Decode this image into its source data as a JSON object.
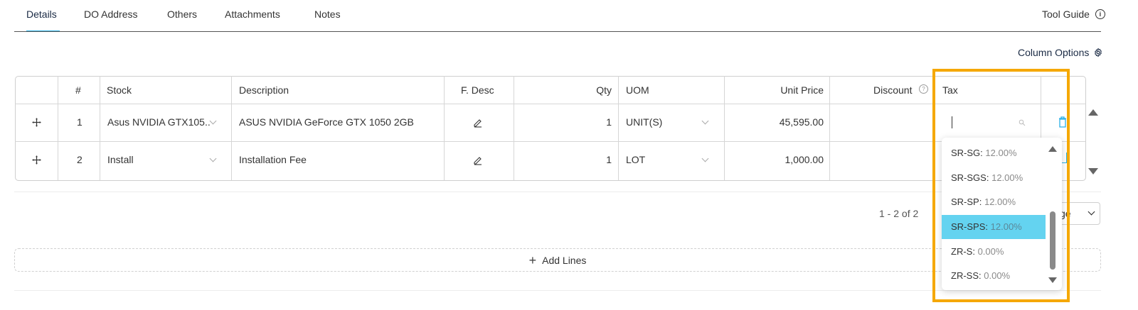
{
  "tabs": [
    {
      "label": "Details"
    },
    {
      "label": "DO Address"
    },
    {
      "label": "Others"
    },
    {
      "label": "Attachments"
    },
    {
      "label": "Notes"
    }
  ],
  "tool_guide": {
    "label": "Tool Guide",
    "icon": "info-icon"
  },
  "column_options": {
    "label": "Column Options",
    "icon": "gear-icon"
  },
  "table": {
    "headers": {
      "num": "#",
      "stock": "Stock",
      "description": "Description",
      "fdesc": "F. Desc",
      "qty": "Qty",
      "uom": "UOM",
      "unit_price": "Unit Price",
      "discount": "Discount",
      "tax": "Tax"
    },
    "rows": [
      {
        "num": "1",
        "stock": "Asus NVIDIA GTX105...",
        "description": "ASUS NVIDIA GeForce GTX 1050 2GB",
        "qty": "1",
        "uom": "UNIT(S)",
        "unit_price": "45,595.00"
      },
      {
        "num": "2",
        "stock": "Install",
        "description": "Installation Fee",
        "qty": "1",
        "uom": "LOT",
        "unit_price": "1,000.00"
      }
    ]
  },
  "pager": {
    "range": "1 - 2 of 2",
    "page_size_partial": "ge"
  },
  "add_lines": {
    "label": "Add Lines"
  },
  "tax_dropdown": {
    "options": [
      {
        "code": "SR-SG:",
        "rate": "12.00%"
      },
      {
        "code": "SR-SGS:",
        "rate": "12.00%"
      },
      {
        "code": "SR-SP:",
        "rate": "12.00%"
      },
      {
        "code": "SR-SPS:",
        "rate": "12.00%",
        "selected": true
      },
      {
        "code": "ZR-S:",
        "rate": "0.00%"
      },
      {
        "code": "ZR-SS:",
        "rate": "0.00%"
      }
    ]
  },
  "colors": {
    "accent": "#2bb1e6",
    "selected_option": "#64d3f0",
    "highlight": "#f5a800"
  }
}
